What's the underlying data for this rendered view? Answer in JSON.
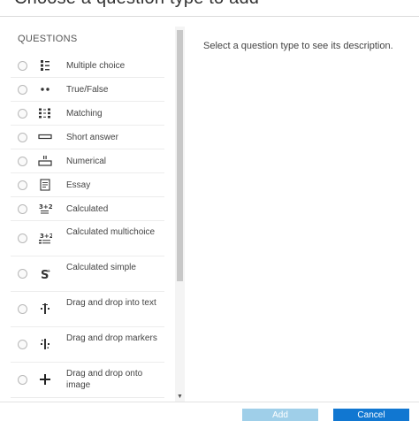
{
  "dialog": {
    "title": "Choose a question type to add",
    "description": "Select a question type to see its description."
  },
  "questions": {
    "header": "QUESTIONS",
    "items": [
      {
        "label": "Multiple choice",
        "icon": "multiple-choice-icon"
      },
      {
        "label": "True/False",
        "icon": "true-false-icon"
      },
      {
        "label": "Matching",
        "icon": "matching-icon"
      },
      {
        "label": "Short answer",
        "icon": "short-answer-icon"
      },
      {
        "label": "Numerical",
        "icon": "numerical-icon"
      },
      {
        "label": "Essay",
        "icon": "essay-icon"
      },
      {
        "label": "Calculated",
        "icon": "calculated-icon"
      },
      {
        "label": "Calculated multichoice",
        "icon": "calculated-multichoice-icon"
      },
      {
        "label": "Calculated simple",
        "icon": "calculated-simple-icon"
      },
      {
        "label": "Drag and drop into text",
        "icon": "drag-drop-text-icon"
      },
      {
        "label": "Drag and drop markers",
        "icon": "drag-drop-markers-icon"
      },
      {
        "label": "Drag and drop onto image",
        "icon": "drag-drop-image-icon"
      }
    ]
  },
  "footer": {
    "add_label": "Add",
    "cancel_label": "Cancel"
  },
  "colors": {
    "add_button": "#9fcfe9",
    "cancel_button": "#1177d1"
  }
}
